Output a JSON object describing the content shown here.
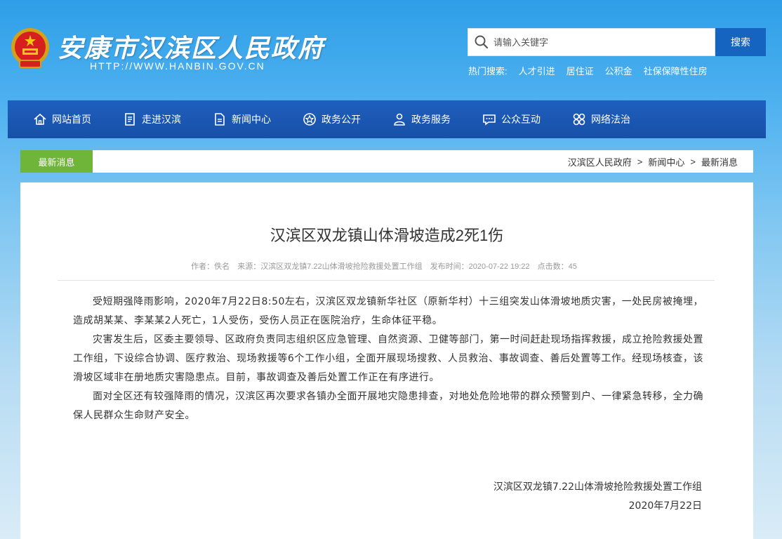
{
  "header": {
    "site_title": "安康市汉滨区人民政府",
    "site_url": "HTTP://WWW.HANBIN.GOV.CN",
    "search": {
      "placeholder": "请输入关键字",
      "button_label": "搜索"
    },
    "hot_search": {
      "label": "热门搜索:",
      "items": [
        "人才引进",
        "居住证",
        "公积金",
        "社保保障性住房"
      ]
    }
  },
  "nav": {
    "items": [
      {
        "label": "网站首页",
        "icon": "home-icon"
      },
      {
        "label": "走进汉滨",
        "icon": "document-icon"
      },
      {
        "label": "新闻中心",
        "icon": "news-icon"
      },
      {
        "label": "政务公开",
        "icon": "star-badge-icon"
      },
      {
        "label": "政务服务",
        "icon": "user-service-icon"
      },
      {
        "label": "公众互动",
        "icon": "chat-icon"
      },
      {
        "label": "网络法治",
        "icon": "grid-icon"
      }
    ]
  },
  "section": {
    "tag": "最新消息",
    "breadcrumb": [
      "汉滨区人民政府",
      "新闻中心",
      "最新消息"
    ],
    "separator": ">"
  },
  "article": {
    "title": "汉滨区双龙镇山体滑坡造成2死1伤",
    "meta": {
      "author": "作者：佚名",
      "source": "来源：汉滨区双龙镇7.22山体滑坡抢险救援处置工作组",
      "published": "发布时间：2020-07-22 19:22",
      "clicks": "点击数：45"
    },
    "paragraphs": [
      "受短期强降雨影响，2020年7月22日8:50左右，汉滨区双龙镇新华社区（原新华村）十三组突发山体滑坡地质灾害，一处民房被掩埋，造成胡某某、李某某2人死亡，1人受伤，受伤人员正在医院治疗，生命体征平稳。",
      "灾害发生后，区委主要领导、区政府负责同志组织区应急管理、自然资源、卫健等部门，第一时间赶赴现场指挥救援，成立抢险救援处置工作组，下设综合协调、医疗救治、现场救援等6个工作小组，全面开展现场搜救、人员救治、事故调查、善后处置等工作。经现场核查，该滑坡区域非在册地质灾害隐患点。目前，事故调查及善后处置工作正在有序进行。",
      "面对全区还有较强降雨的情况，汉滨区再次要求各镇办全面开展地灾隐患排查，对地处危险地带的群众预警到户、一律紧急转移，全力确保人民群众生命财产安全。"
    ],
    "signature": "汉滨区双龙镇7.22山体滑坡抢险救援处置工作组",
    "date": "2020年7月22日"
  }
}
